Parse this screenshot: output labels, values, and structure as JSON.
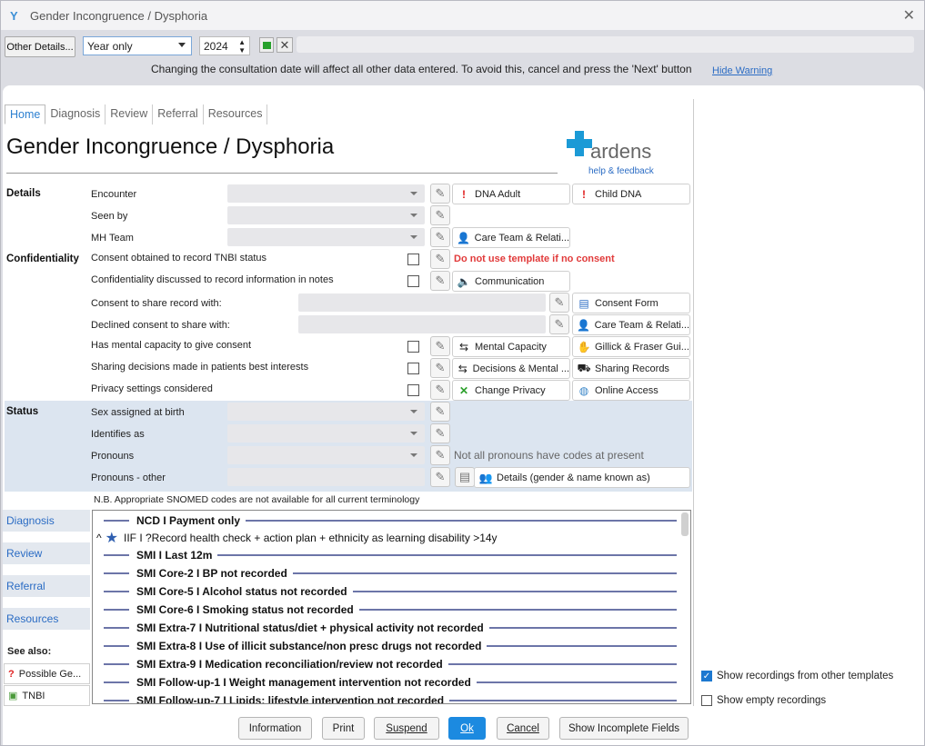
{
  "window": {
    "title": "Gender Incongruence / Dysphoria"
  },
  "toolbar": {
    "other_details": "Other Details...",
    "date_mode": "Year only",
    "year": "2024"
  },
  "warning": {
    "text": "Changing the consultation date will affect all other data entered. To avoid this, cancel and press the 'Next' button",
    "hide": "Hide Warning"
  },
  "tabs": [
    "Home",
    "Diagnosis",
    "Review",
    "Referral",
    "Resources"
  ],
  "heading": "Gender Incongruence / Dysphoria",
  "ardens": {
    "name": "ardens",
    "sub": "help & feedback"
  },
  "sections": {
    "details": "Details",
    "confidentiality": "Confidentiality",
    "status": "Status"
  },
  "fields": {
    "encounter": "Encounter",
    "seen_by": "Seen by",
    "mh_team": "MH Team",
    "consent_tnbi": "Consent obtained to record TNBI status",
    "conf_discussed": "Confidentiality discussed to record information in notes",
    "consent_share": "Consent to share record with:",
    "declined_share": "Declined consent to share with:",
    "mental_capacity": "Has mental capacity to give consent",
    "best_interests": "Sharing decisions made in patients best interests",
    "privacy": "Privacy settings considered",
    "sex_birth": "Sex assigned at birth",
    "identifies": "Identifies as",
    "pronouns": "Pronouns",
    "pronouns_other": "Pronouns - other"
  },
  "links": {
    "dna_adult": "DNA Adult",
    "child_dna": "Child DNA",
    "care_team": "Care Team & Relati...",
    "communication": "Communication",
    "consent_form": "Consent Form",
    "care_team2": "Care Team & Relati...",
    "mental_capacity": "Mental Capacity",
    "gillick": "Gillick & Fraser Gui...",
    "decisions": "Decisions & Mental ...",
    "sharing_records": "Sharing Records",
    "change_privacy": "Change Privacy",
    "online_access": "Online Access",
    "details_gender": "Details (gender & name known as)"
  },
  "warning_red": "Do not use template if no consent",
  "pronoun_note": "Not all pronouns have codes at present",
  "snomed_note": "N.B. Appropriate SNOMED codes are not available for all current terminology",
  "side_tabs": [
    "Diagnosis",
    "Review",
    "Referral",
    "Resources"
  ],
  "see_also": {
    "title": "See also:",
    "items": [
      "Possible Ge...",
      "TNBI"
    ]
  },
  "list_rows": [
    "NCD I Payment only",
    "IIF I ?Record health check + action plan + ethnicity as learning disability >14y",
    "SMI I Last 12m",
    "SMI Core-2 I BP not recorded",
    "SMI Core-5 I Alcohol status not recorded",
    "SMI Core-6 I Smoking status not recorded",
    "SMI Extra-7 I Nutritional status/diet + physical activity not recorded",
    "SMI Extra-8 I Use of illicit substance/non presc drugs not recorded",
    "SMI Extra-9 I Medication reconciliation/review not recorded",
    "SMI Follow-up-1 I Weight management intervention not recorded",
    "SMI Follow-up-7 I Lipids: lifestyle intervention not recorded"
  ],
  "options": {
    "show_other": "Show recordings from other templates",
    "show_empty": "Show empty recordings"
  },
  "footer": {
    "information": "Information",
    "print": "Print",
    "suspend": "Suspend",
    "ok": "Ok",
    "cancel": "Cancel",
    "incomplete": "Show Incomplete Fields"
  }
}
